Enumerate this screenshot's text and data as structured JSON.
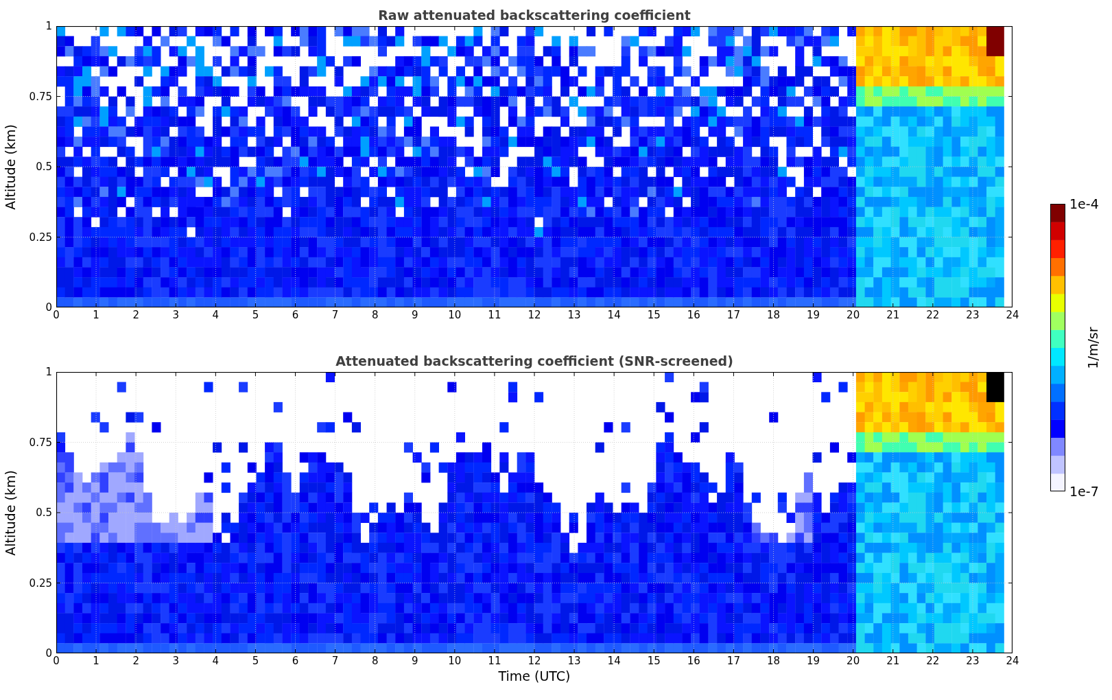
{
  "panels": [
    {
      "kind": "raw",
      "title": "Raw attenuated backscattering coefficient",
      "ylabel": "Altitude (km)",
      "yticks": [
        "1",
        "0.75",
        "0.5",
        "0.25",
        "0"
      ],
      "xticks": [
        "0",
        "1",
        "2",
        "3",
        "4",
        "5",
        "6",
        "7",
        "8",
        "9",
        "10",
        "11",
        "12",
        "13",
        "14",
        "15",
        "16",
        "17",
        "18",
        "19",
        "20",
        "21",
        "22",
        "23",
        "24"
      ]
    },
    {
      "kind": "screened",
      "title": "Attenuated backscattering coefficient (SNR-screened)",
      "ylabel": "Altitude (km)",
      "yticks": [
        "1",
        "0.75",
        "0.5",
        "0.25",
        "0"
      ],
      "xticks": [
        "0",
        "1",
        "2",
        "3",
        "4",
        "5",
        "6",
        "7",
        "8",
        "9",
        "10",
        "11",
        "12",
        "13",
        "14",
        "15",
        "16",
        "17",
        "18",
        "19",
        "20",
        "21",
        "22",
        "23",
        "24"
      ],
      "xlabel": "Time (UTC)"
    }
  ],
  "colorbar": {
    "label": "1/m/sr",
    "top": "1e-4",
    "bottom": "1e-7"
  }
}
